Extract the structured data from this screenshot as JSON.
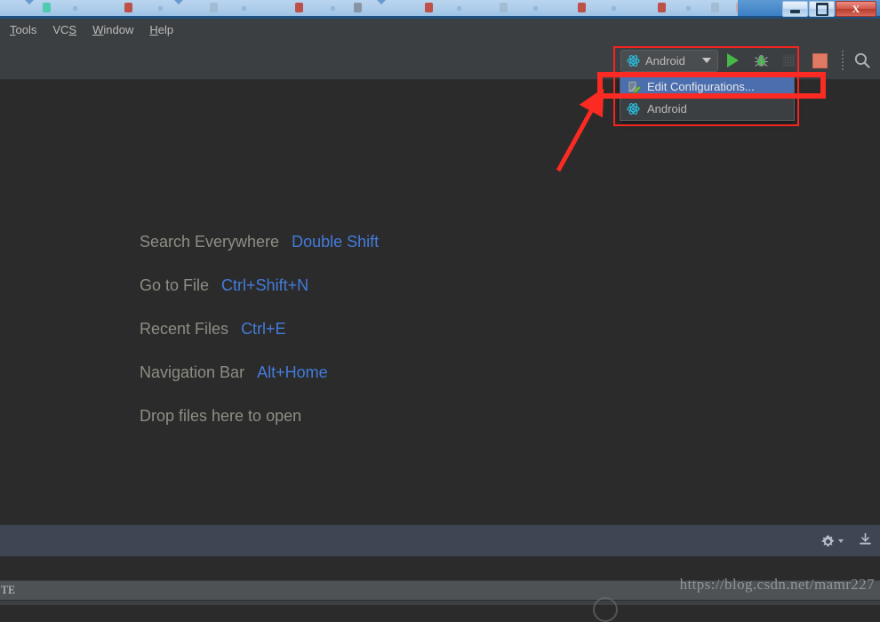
{
  "window": {
    "controls": [
      {
        "name": "minimize",
        "glyph": "minimize-icon"
      },
      {
        "name": "maximize",
        "glyph": "maximize-icon"
      },
      {
        "name": "close",
        "glyph": "close-icon",
        "label": "X"
      }
    ]
  },
  "menubar": {
    "items": [
      {
        "label": "Tools",
        "mnemonic": "T",
        "rest": "ools"
      },
      {
        "label": "VCS",
        "mnemonic": "S",
        "pre": "VC"
      },
      {
        "label": "Window",
        "mnemonic": "W",
        "rest": "indow"
      },
      {
        "label": "Help",
        "mnemonic": "H",
        "rest": "elp"
      }
    ]
  },
  "toolbar": {
    "run_config": {
      "label": "Android",
      "icon": "android-config-icon",
      "caret": "chevron-down-icon"
    },
    "buttons": [
      {
        "name": "run-button",
        "icon": "play-icon",
        "tooltip": "Run"
      },
      {
        "name": "debug-button",
        "icon": "bug-icon",
        "tooltip": "Debug"
      },
      {
        "name": "run-coverage-button",
        "icon": "coverage-icon",
        "tooltip": "Run with Coverage"
      },
      {
        "name": "stop-button",
        "icon": "stop-icon",
        "tooltip": "Stop"
      },
      {
        "name": "search-everywhere",
        "icon": "search-icon",
        "tooltip": "Search"
      }
    ]
  },
  "dropdown": {
    "items": [
      {
        "label": "Edit Configurations...",
        "icon": "edit-configurations-icon",
        "selected": true
      },
      {
        "label": "Android",
        "icon": "android-config-icon",
        "selected": false
      }
    ]
  },
  "editor": {
    "hints": [
      {
        "label": "Search Everywhere",
        "key": "Double Shift"
      },
      {
        "label": "Go to File",
        "key": "Ctrl+Shift+N"
      },
      {
        "label": "Recent Files",
        "key": "Ctrl+E"
      },
      {
        "label": "Navigation Bar",
        "key": "Alt+Home"
      },
      {
        "label": "Drop files here to open",
        "key": ""
      }
    ]
  },
  "bottom_panel": {
    "icons": [
      {
        "name": "settings-gear-icon"
      },
      {
        "name": "download-icon"
      }
    ]
  },
  "statusbar": {
    "left_text": "TE"
  },
  "watermark": {
    "text": "https://blog.csdn.net/mamr227"
  },
  "colors": {
    "editor_bg": "#2b2b2b",
    "toolbar_bg": "#3c3f41",
    "selection_blue": "#4b6eaf",
    "hint_key_blue": "#447bdb",
    "annotation_red": "#f4241f",
    "run_green": "#46b946",
    "stop_red": "#e07a64",
    "bottom_panel_bg": "#3e4654"
  }
}
